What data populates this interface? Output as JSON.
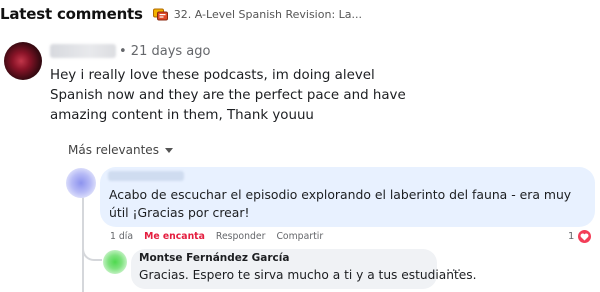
{
  "header": {
    "title": "Latest comments",
    "episode_icon": "podcast-episode-icon",
    "episode_title": "32. A-Level Spanish Revision: La..."
  },
  "comments": [
    {
      "author_redacted": true,
      "time": "• 21 days ago",
      "text": "Hey i really love these podcasts, im doing alevel Spanish now and they are the perfect pace and have amazing content in them, Thank youuu"
    }
  ],
  "sort": {
    "label": "Más relevantes",
    "icon": "caret-down-icon"
  },
  "reply": {
    "author_redacted": true,
    "text": "Acabo de escuchar el episodio explorando el laberinto del fauna - era muy útil ¡Gracias por crear!",
    "actions": {
      "time": "1 día",
      "like": "Me encanta",
      "reply": "Responder",
      "share": "Compartir"
    },
    "reaction_count": "1",
    "reaction_icon": "heart-icon"
  },
  "nested_reply": {
    "author": "Montse Fernández García",
    "text": "Gracias. Espero te sirva mucho a ti y a tus estudiantes.",
    "more_label": "···"
  },
  "colors": {
    "like_red": "#e41e3f",
    "reply_bubble": "#e8f1ff",
    "nested_bubble": "#f0f2f5",
    "heart": "#f33e58"
  }
}
